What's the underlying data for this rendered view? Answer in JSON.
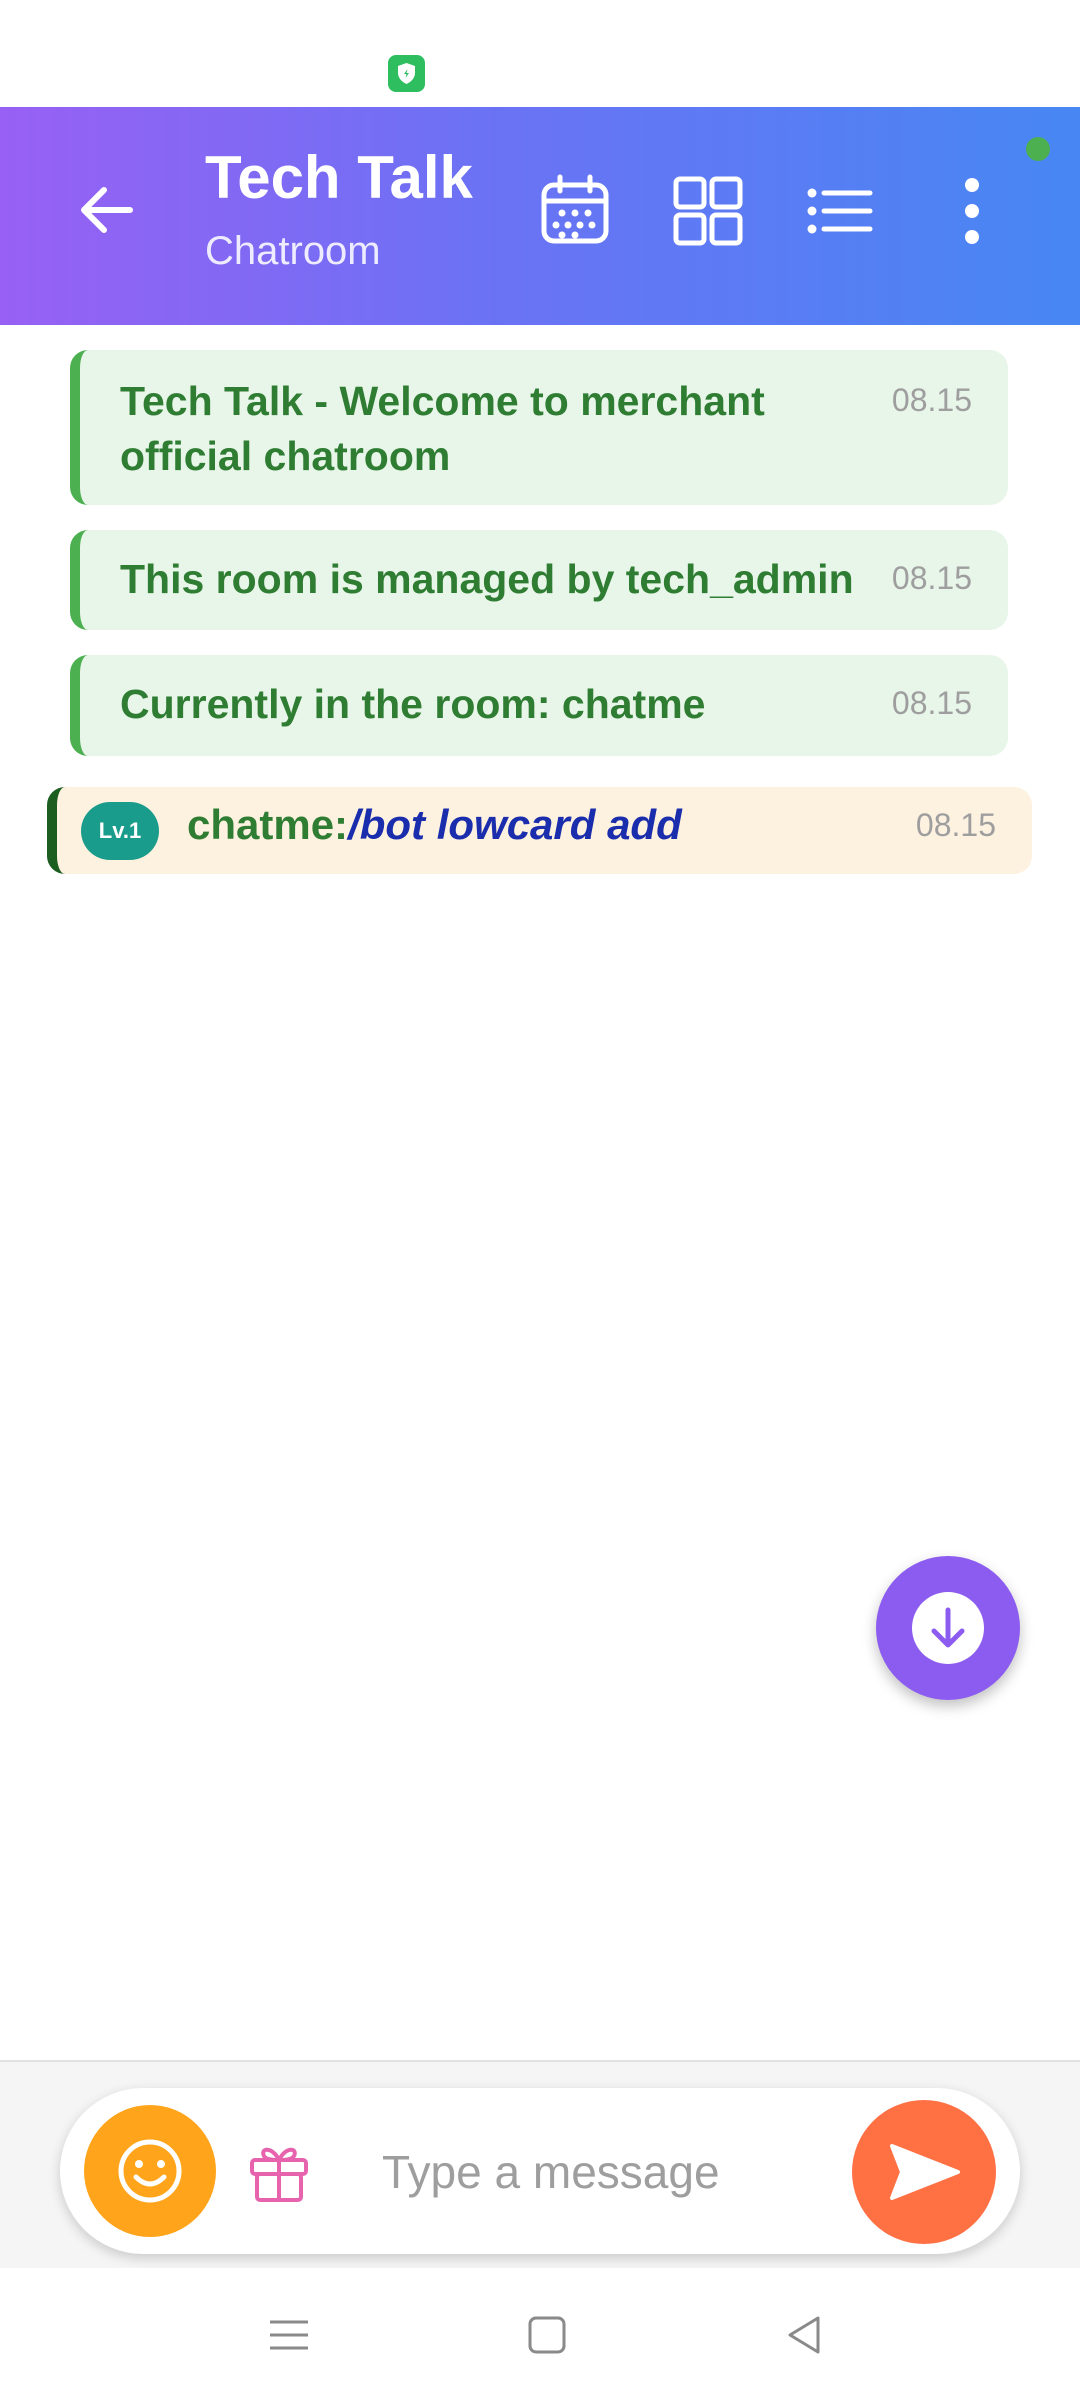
{
  "header": {
    "title": "Tech Talk",
    "subtitle": "Chatroom",
    "gradient": [
      "#9860f4",
      "#4787f3"
    ]
  },
  "messages": {
    "system": [
      {
        "text_line1": "Tech Talk - Welcome to merchant",
        "text_line2": "official chatroom",
        "time": "08.15"
      },
      {
        "text": "This room is managed by tech_admin",
        "time": "08.15"
      },
      {
        "text": "Currently in the room: chatme",
        "time": "08.15"
      }
    ],
    "user": {
      "level": "Lv.1",
      "username": "chatme:",
      "command": "/bot lowcard add",
      "time": "08.15"
    }
  },
  "composer": {
    "placeholder": "Type a message",
    "emoji_color": "#ffa41b",
    "send_color": "#ff7043"
  },
  "fab_color": "#8c5cf0",
  "icons": [
    "back-arrow-icon",
    "calendar-icon",
    "grid-icon",
    "list-icon",
    "more-vert-icon",
    "scroll-down-icon",
    "emoji-icon",
    "gift-icon",
    "send-icon",
    "menu-icon",
    "home-icon",
    "back-icon",
    "shield-icon"
  ]
}
